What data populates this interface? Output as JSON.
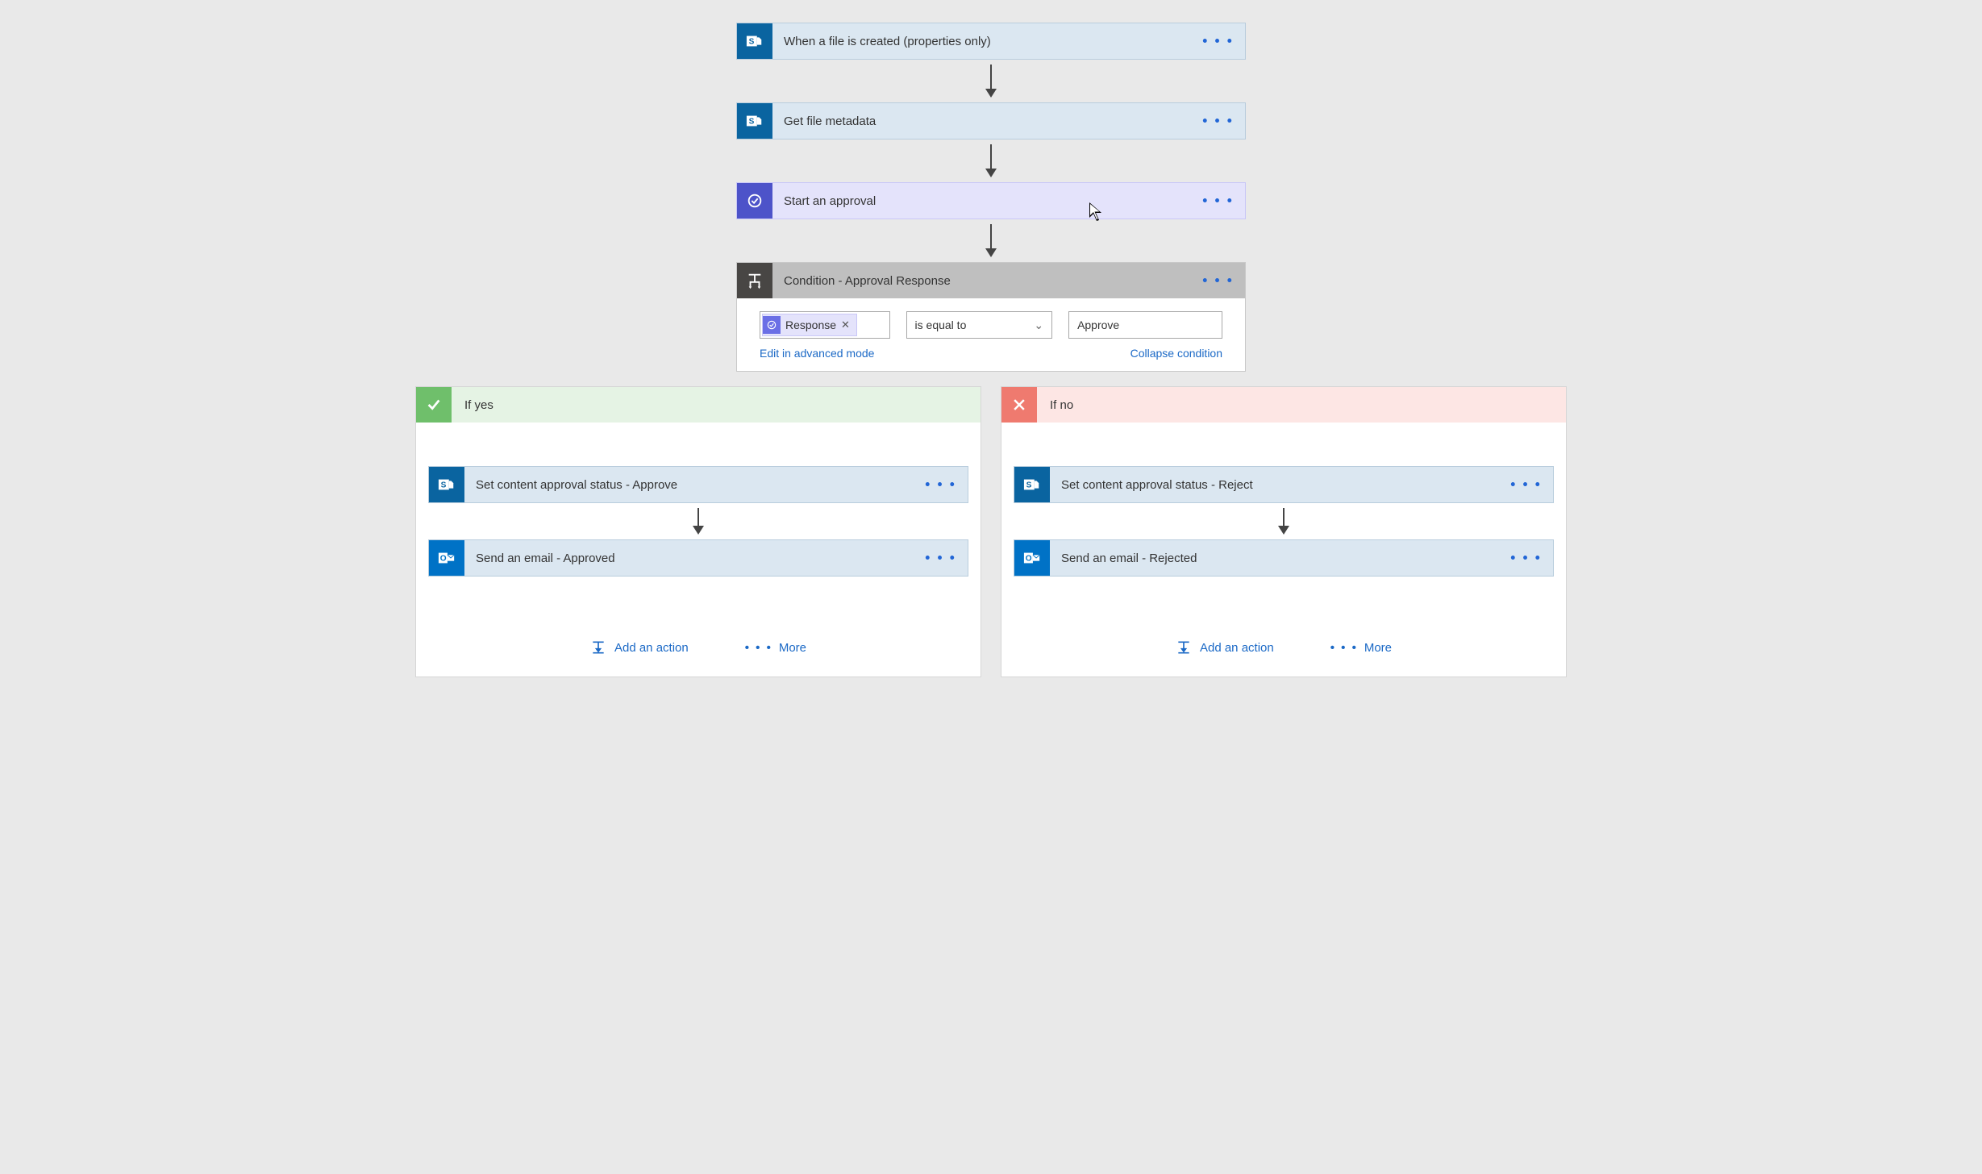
{
  "flow": {
    "step1": {
      "title": "When a file is created (properties only)",
      "icon": "sharepoint"
    },
    "step2": {
      "title": "Get file metadata",
      "icon": "sharepoint"
    },
    "step3": {
      "title": "Start an approval",
      "icon": "approval"
    },
    "condition": {
      "title": "Condition - Approval Response",
      "left_chip": "Response",
      "operator": "is equal to",
      "value": "Approve",
      "edit_link": "Edit in advanced mode",
      "collapse_link": "Collapse condition"
    },
    "yes": {
      "header": "If yes",
      "action1": {
        "title": "Set content approval status - Approve",
        "icon": "sharepoint"
      },
      "action2": {
        "title": "Send an email - Approved",
        "icon": "outlook"
      }
    },
    "no": {
      "header": "If no",
      "action1": {
        "title": "Set content approval status - Reject",
        "icon": "sharepoint"
      },
      "action2": {
        "title": "Send an email - Rejected",
        "icon": "outlook"
      }
    },
    "footer": {
      "add_action": "Add an action",
      "more": "More"
    }
  },
  "colors": {
    "sharepoint": "#0a64a0",
    "approval": "#4d53c9",
    "outlook": "#0072c6",
    "condition": "#484644",
    "yes": "#6fbf6b",
    "no": "#ef7a6f",
    "link": "#1b69c6"
  }
}
